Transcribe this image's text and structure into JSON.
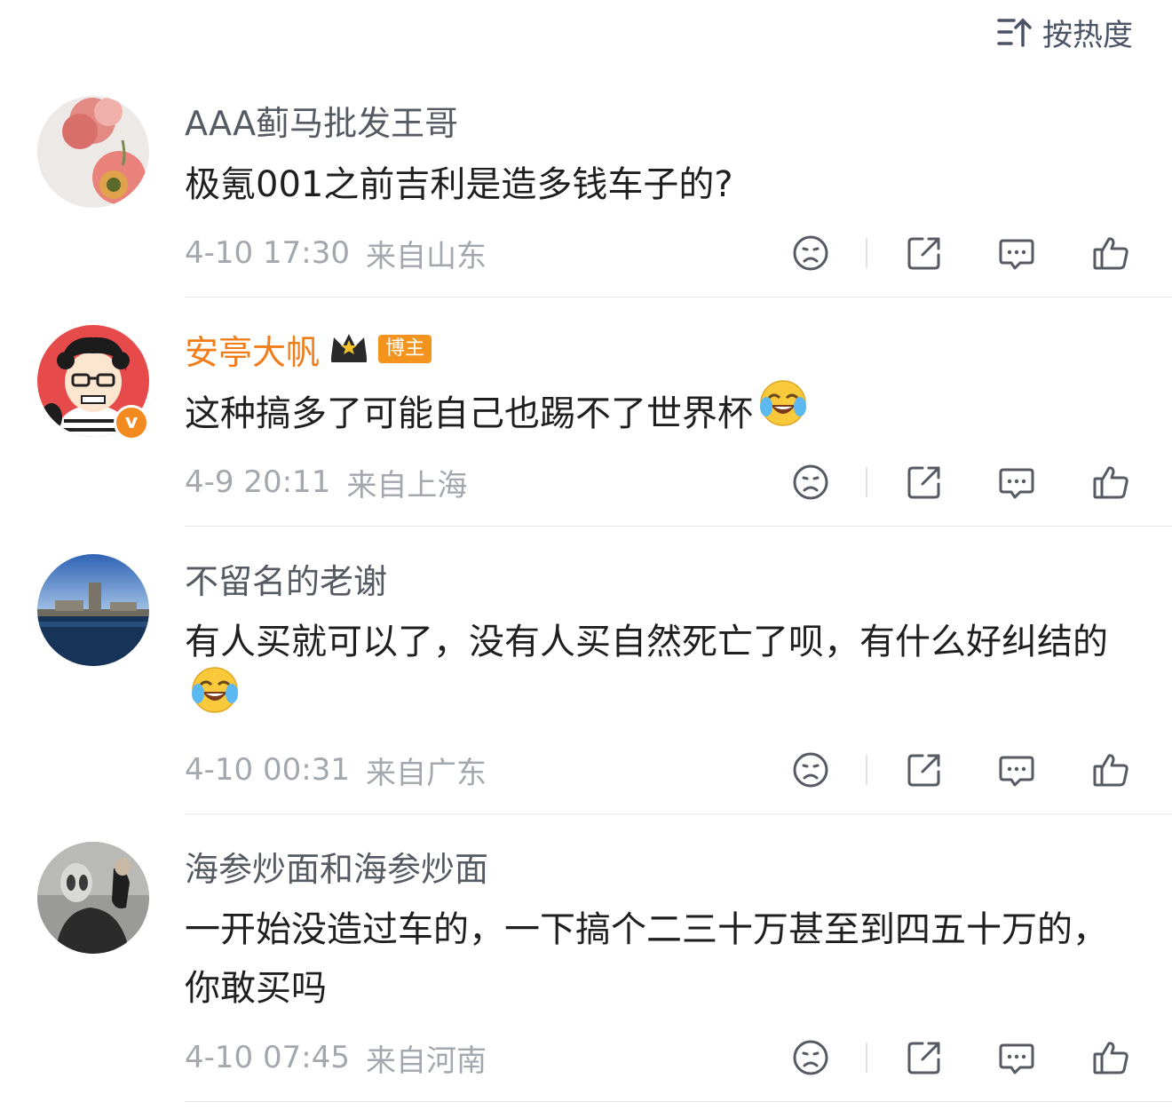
{
  "sort": {
    "label": "按热度",
    "icon": "sort-hot-icon"
  },
  "comments": [
    {
      "username": "AAA蓟马批发王哥",
      "verified": false,
      "text": "极氪001之前吉利是造多钱车子的?",
      "time": "4-10 17:30",
      "location": "来自山东"
    },
    {
      "username": "安亭大帆",
      "verified": true,
      "badge": "v",
      "tag": "博主",
      "crown": "crown-icon",
      "text": "这种搞多了可能自己也踢不了世界杯",
      "emoji": "laugh-cry-emoji",
      "time": "4-9 20:11",
      "location": "来自上海"
    },
    {
      "username": "不留名的老谢",
      "verified": false,
      "text": "有人买就可以了，没有人买自然死亡了呗，有什么好纠结的",
      "emoji": "laugh-cry-emoji",
      "time": "4-10 00:31",
      "location": "来自广东"
    },
    {
      "username": "海参炒面和海参炒面",
      "verified": false,
      "text": "一开始没造过车的，一下搞个二三十万甚至到四五十万的，你敢买吗",
      "time": "4-10 07:45",
      "location": "来自河南"
    }
  ],
  "actions": [
    "dislike-icon",
    "share-icon",
    "reply-icon",
    "like-icon"
  ],
  "colors": {
    "vip_name": "#f07d1a",
    "badge": "#f28a1f",
    "meta": "#a3a7ae",
    "icon": "#555a63"
  }
}
